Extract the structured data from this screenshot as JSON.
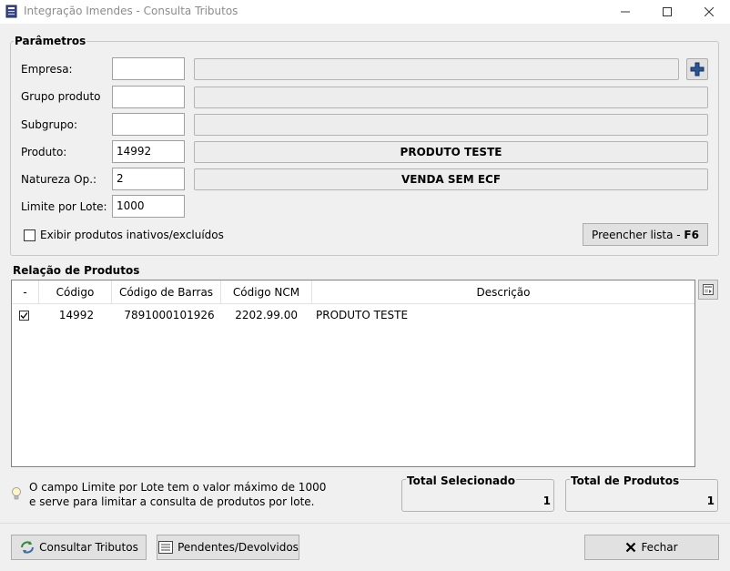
{
  "window": {
    "title": "Integração Imendes - Consulta Tributos",
    "icon": "app-document-icon"
  },
  "params": {
    "group_label": "Parâmetros",
    "fields": [
      {
        "label": "Empresa:",
        "value": "",
        "description": ""
      },
      {
        "label": "Grupo produto",
        "value": "",
        "description": ""
      },
      {
        "label": "Subgrupo:",
        "value": "",
        "description": ""
      },
      {
        "label": "Produto:",
        "value": "14992",
        "description": "PRODUTO TESTE"
      },
      {
        "label": "Natureza Op.:",
        "value": "2",
        "description": "VENDA SEM ECF"
      }
    ],
    "limit_label": "Limite por Lote:",
    "limit_value": "1000",
    "checkbox_label": "Exibir produtos inativos/excluídos",
    "checkbox_checked": false,
    "fill_button_label": "Preencher lista - ",
    "fill_button_key": "F6"
  },
  "products": {
    "group_label": "Relação de Produtos",
    "columns": [
      "-",
      "Código",
      "Código de Barras",
      "Código NCM",
      "Descrição"
    ],
    "rows": [
      {
        "checked": true,
        "codigo": "14992",
        "barras": "7891000101926",
        "ncm": "2202.99.00",
        "descricao": "PRODUTO TESTE"
      }
    ]
  },
  "info": {
    "line1": "O campo Limite por Lote tem o valor máximo de 1000",
    "line2": "e serve para limitar a consulta de produtos por lote."
  },
  "totals": {
    "selected_label": "Total Selecionado",
    "selected_value": "1",
    "products_label": "Total de Produtos",
    "products_value": "1"
  },
  "footer": {
    "consult_label": "Consultar Tributos",
    "pending_label": "Pendentes/Devolvidos",
    "close_label": "Fechar"
  },
  "colors": {
    "plus_icon": "#2b5797",
    "window_bg": "#f0f0f0"
  }
}
